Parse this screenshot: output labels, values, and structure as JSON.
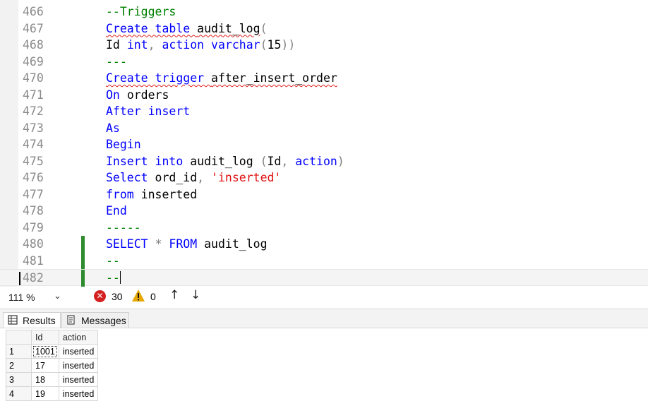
{
  "editor": {
    "lines": [
      {
        "num": "466",
        "tokens": [
          {
            "t": "--Triggers",
            "c": "comment"
          }
        ]
      },
      {
        "num": "467",
        "tokens": [
          {
            "t": "Create table ",
            "c": "kw",
            "err": true
          },
          {
            "t": "audit_log",
            "c": "id",
            "err": true
          },
          {
            "t": "(",
            "c": "op"
          }
        ]
      },
      {
        "num": "468",
        "tokens": [
          {
            "t": "Id ",
            "c": "id"
          },
          {
            "t": "int",
            "c": "kw"
          },
          {
            "t": ", ",
            "c": "op"
          },
          {
            "t": "action ",
            "c": "kw"
          },
          {
            "t": "varchar",
            "c": "kw"
          },
          {
            "t": "(",
            "c": "op"
          },
          {
            "t": "15",
            "c": "id"
          },
          {
            "t": "))",
            "c": "op"
          }
        ]
      },
      {
        "num": "469",
        "tokens": [
          {
            "t": "---",
            "c": "comment"
          }
        ]
      },
      {
        "num": "470",
        "tokens": [
          {
            "t": "Create trigger ",
            "c": "kw",
            "err": true
          },
          {
            "t": "after_insert_order",
            "c": "id",
            "err": true
          }
        ]
      },
      {
        "num": "471",
        "tokens": [
          {
            "t": "On ",
            "c": "kw"
          },
          {
            "t": "orders",
            "c": "id"
          }
        ]
      },
      {
        "num": "472",
        "tokens": [
          {
            "t": "After insert",
            "c": "kw"
          }
        ]
      },
      {
        "num": "473",
        "tokens": [
          {
            "t": "As",
            "c": "kw"
          }
        ]
      },
      {
        "num": "474",
        "tokens": [
          {
            "t": "Begin",
            "c": "kw"
          }
        ]
      },
      {
        "num": "475",
        "tokens": [
          {
            "t": "Insert into ",
            "c": "kw"
          },
          {
            "t": "audit_log ",
            "c": "id"
          },
          {
            "t": "(",
            "c": "op"
          },
          {
            "t": "Id",
            "c": "id"
          },
          {
            "t": ", ",
            "c": "op"
          },
          {
            "t": "action",
            "c": "kw"
          },
          {
            "t": ")",
            "c": "op"
          }
        ]
      },
      {
        "num": "476",
        "tokens": [
          {
            "t": "Select ",
            "c": "kw"
          },
          {
            "t": "ord_id",
            "c": "id"
          },
          {
            "t": ", ",
            "c": "op"
          },
          {
            "t": "'inserted'",
            "c": "str"
          }
        ]
      },
      {
        "num": "477",
        "tokens": [
          {
            "t": "from ",
            "c": "kw"
          },
          {
            "t": "inserted",
            "c": "id"
          }
        ]
      },
      {
        "num": "478",
        "tokens": [
          {
            "t": "End",
            "c": "kw"
          }
        ]
      },
      {
        "num": "479",
        "tokens": [
          {
            "t": "-----",
            "c": "comment"
          }
        ]
      },
      {
        "num": "480",
        "tokens": [
          {
            "t": "SELECT ",
            "c": "kw"
          },
          {
            "t": "* ",
            "c": "op"
          },
          {
            "t": "FROM ",
            "c": "kw"
          },
          {
            "t": "audit_log",
            "c": "id"
          }
        ],
        "changed": true
      },
      {
        "num": "481",
        "tokens": [
          {
            "t": "--",
            "c": "comment"
          }
        ],
        "changed": true
      },
      {
        "num": "482",
        "tokens": [
          {
            "t": "--",
            "c": "comment"
          }
        ],
        "changed": true,
        "current": true
      }
    ]
  },
  "status": {
    "zoom": "111 %",
    "errors": "30",
    "warnings": "0"
  },
  "tabs": {
    "results": "Results",
    "messages": "Messages"
  },
  "results": {
    "columns": [
      "Id",
      "action"
    ],
    "rows": [
      {
        "n": "1",
        "cells": [
          "1001",
          "inserted"
        ]
      },
      {
        "n": "2",
        "cells": [
          "17",
          "inserted"
        ]
      },
      {
        "n": "3",
        "cells": [
          "18",
          "inserted"
        ]
      },
      {
        "n": "4",
        "cells": [
          "19",
          "inserted"
        ]
      }
    ]
  },
  "colors": {
    "keyword": "#0000ff",
    "comment": "#008000",
    "string": "#e01010",
    "operator": "#808080",
    "change_bar": "#2e8b2e",
    "error": "#d32020",
    "warning": "#e6a700"
  }
}
